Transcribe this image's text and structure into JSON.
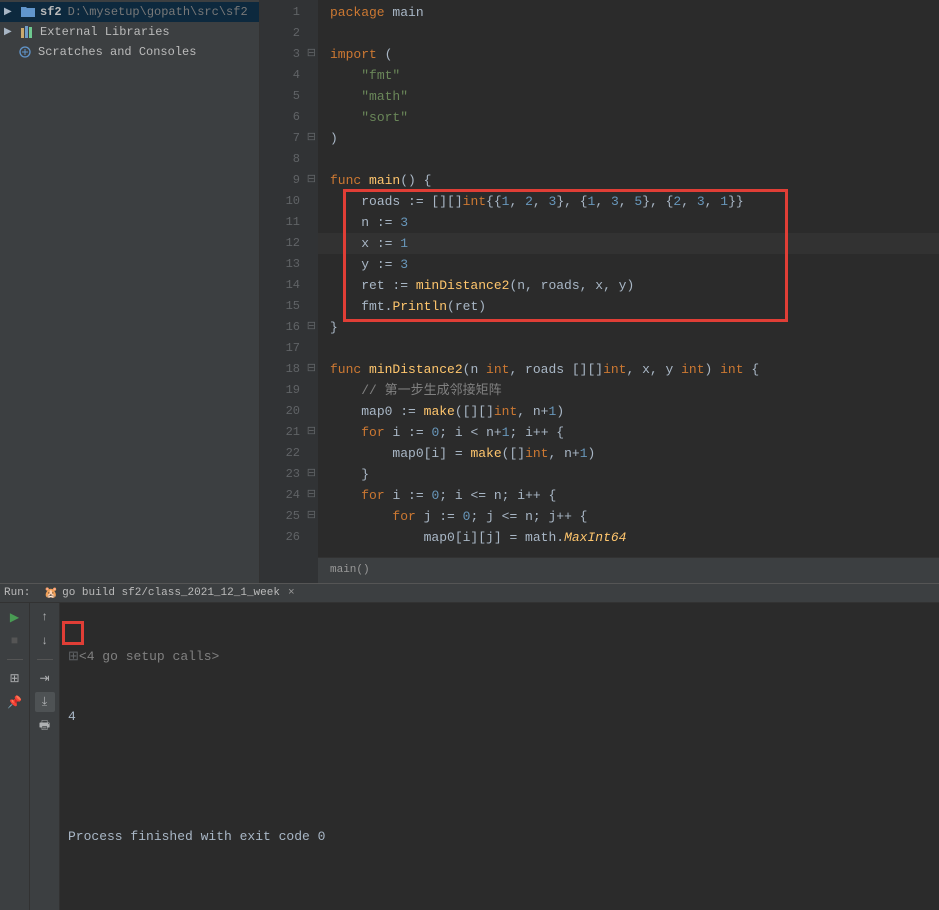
{
  "sidebar": {
    "project": {
      "name": "sf2",
      "path": "D:\\mysetup\\gopath\\src\\sf2"
    },
    "libs": "External Libraries",
    "scratches": "Scratches and Consoles"
  },
  "gutter": [
    "1",
    "2",
    "3",
    "4",
    "5",
    "6",
    "7",
    "8",
    "9",
    "10",
    "11",
    "12",
    "13",
    "14",
    "15",
    "16",
    "17",
    "18",
    "19",
    "20",
    "21",
    "22",
    "23",
    "24",
    "25",
    "26"
  ],
  "code": {
    "l1_kw": "package ",
    "l1_id": "main",
    "l3_kw": "import ",
    "l3_p": "(",
    "l4": "\"fmt\"",
    "l5": "\"math\"",
    "l6": "\"sort\"",
    "l7": ")",
    "l9_kw": "func ",
    "l9_fn": "main",
    "l9_rest": "() {",
    "l10_a": "roads := [][]",
    "l10_t": "int",
    "l10_b": "{{",
    "l10_n1": "1",
    "l10_c": ", ",
    "l10_n2": "2",
    "l10_d": ", ",
    "l10_n3": "3",
    "l10_e": "}, {",
    "l10_n4": "1",
    "l10_f": ", ",
    "l10_n5": "3",
    "l10_g": ", ",
    "l10_n6": "5",
    "l10_h": "}, {",
    "l10_n7": "2",
    "l10_i": ", ",
    "l10_n8": "3",
    "l10_j": ", ",
    "l10_n9": "1",
    "l10_k": "}}",
    "l11_a": "n := ",
    "l11_n": "3",
    "l12_a": "x := ",
    "l12_n": "1",
    "l13_a": "y := ",
    "l13_n": "3",
    "l14_a": "ret := ",
    "l14_fn": "minDistance2",
    "l14_b": "(n, roads, x, y)",
    "l15_a": "fmt.",
    "l15_fn": "Println",
    "l15_b": "(ret)",
    "l16": "}",
    "l18_kw": "func ",
    "l18_fn": "minDistance2",
    "l18_a": "(n ",
    "l18_t1": "int",
    "l18_b": ", roads [][]",
    "l18_t2": "int",
    "l18_c": ", x, y ",
    "l18_t3": "int",
    "l18_d": ") ",
    "l18_t4": "int",
    "l18_e": " {",
    "l19": "// 第一步生成邻接矩阵",
    "l20_a": "map0 := ",
    "l20_fn": "make",
    "l20_b": "([][]",
    "l20_t": "int",
    "l20_c": ", n+",
    "l20_n": "1",
    "l20_d": ")",
    "l21_kw": "for ",
    "l21_a": "i := ",
    "l21_n1": "0",
    "l21_b": "; i < n+",
    "l21_n2": "1",
    "l21_c": "; i++ {",
    "l22_a": "map0[i] = ",
    "l22_fn": "make",
    "l22_b": "([]",
    "l22_t": "int",
    "l22_c": ", n+",
    "l22_n": "1",
    "l22_d": ")",
    "l23": "}",
    "l24_kw": "for ",
    "l24_a": "i := ",
    "l24_n1": "0",
    "l24_b": "; i <= n; i++ {",
    "l25_kw": "for ",
    "l25_a": "j := ",
    "l25_n1": "0",
    "l25_b": "; j <= n; j++ {",
    "l26_a": "map0[i][j] = math.",
    "l26_fn": "MaxInt64"
  },
  "breadcrumb": "main()",
  "run": {
    "label": "Run:",
    "tab": "go build sf2/class_2021_12_1_week",
    "setup": "<4 go setup calls>",
    "output": "4",
    "exit": "Process finished with exit code 0"
  }
}
